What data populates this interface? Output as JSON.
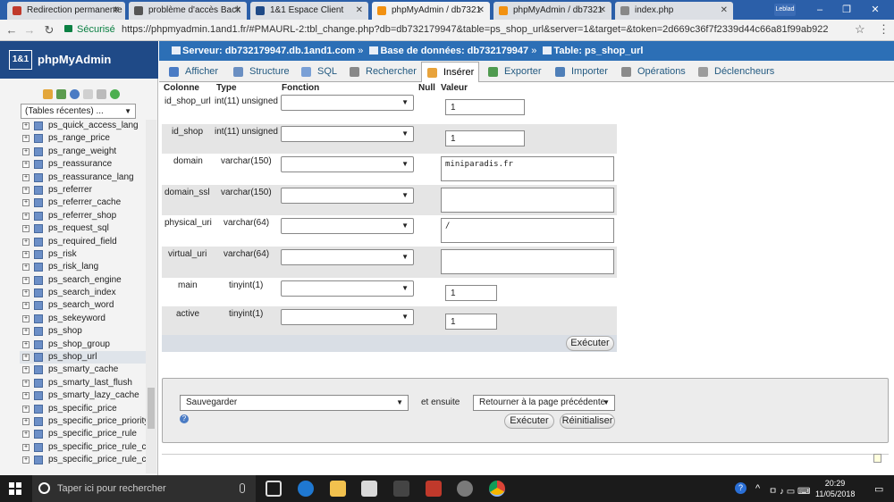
{
  "browser": {
    "tabs": [
      {
        "title": "Redirection permanente",
        "favicon": "page-icon",
        "color": "#c0392b"
      },
      {
        "title": "problème d'accès Back",
        "favicon": "forum-icon",
        "color": "#555555"
      },
      {
        "title": "1&1 Espace Client",
        "favicon": "ionos-icon",
        "color": "#1f4a87"
      },
      {
        "title": "phpMyAdmin / db7321",
        "favicon": "pma-icon",
        "color": "#f29111"
      },
      {
        "title": "phpMyAdmin / db7321",
        "favicon": "pma-icon",
        "color": "#f29111"
      },
      {
        "title": "index.php",
        "favicon": "file-icon",
        "color": "#888888"
      }
    ],
    "user_badge": "Leblad",
    "window_controls": {
      "minimize": "–",
      "maximize": "❐",
      "close": "✕"
    },
    "secure_label": "Sécurisé",
    "url": "https://phpmyadmin.1and1.fr/#PMAURL-2:tbl_change.php?db=db732179947&table=ps_shop_url&server=1&target=&token=2d669c36f7f2339d44c66a81f99ab922"
  },
  "pma": {
    "logo_box": "1&1",
    "logo_text": "phpMyAdmin",
    "recent_tables": "(Tables récentes) ...",
    "tree": [
      "ps_quick_access_lang",
      "ps_range_price",
      "ps_range_weight",
      "ps_reassurance",
      "ps_reassurance_lang",
      "ps_referrer",
      "ps_referrer_cache",
      "ps_referrer_shop",
      "ps_request_sql",
      "ps_required_field",
      "ps_risk",
      "ps_risk_lang",
      "ps_search_engine",
      "ps_search_index",
      "ps_search_word",
      "ps_sekeyword",
      "ps_shop",
      "ps_shop_group",
      "ps_shop_url",
      "ps_smarty_cache",
      "ps_smarty_last_flush",
      "ps_smarty_lazy_cache",
      "ps_specific_price",
      "ps_specific_price_priority",
      "ps_specific_price_rule",
      "ps_specific_price_rule_co",
      "ps_specific_price_rule_co"
    ],
    "selected_table": "ps_shop_url",
    "breadcrumb": {
      "server": "Serveur: db732179947.db.1and1.com",
      "database": "Base de données: db732179947",
      "table": "Table: ps_shop_url",
      "separator": "»"
    },
    "tabs": [
      {
        "label": "Afficher",
        "icon": "browse-icon",
        "color": "#4a7bc4"
      },
      {
        "label": "Structure",
        "icon": "structure-icon",
        "color": "#6b8fc2"
      },
      {
        "label": "SQL",
        "icon": "sql-icon",
        "color": "#7aa0d6"
      },
      {
        "label": "Rechercher",
        "icon": "search-icon",
        "color": "#888888"
      },
      {
        "label": "Insérer",
        "icon": "insert-icon",
        "color": "#e8a33b"
      },
      {
        "label": "Exporter",
        "icon": "export-icon",
        "color": "#4f9a4f"
      },
      {
        "label": "Importer",
        "icon": "import-icon",
        "color": "#4f7fb8"
      },
      {
        "label": "Opérations",
        "icon": "operations-icon",
        "color": "#8b8b8b"
      },
      {
        "label": "Déclencheurs",
        "icon": "triggers-icon",
        "color": "#9c9c9c"
      }
    ],
    "active_tab": "Insérer",
    "form": {
      "headers": {
        "column": "Colonne",
        "type": "Type",
        "function": "Fonction",
        "null": "Null",
        "value": "Valeur"
      },
      "rows": [
        {
          "name": "id_shop_url",
          "type": "int(11) unsigned",
          "value": "1",
          "input": "text"
        },
        {
          "name": "id_shop",
          "type": "int(11) unsigned",
          "value": "1",
          "input": "text"
        },
        {
          "name": "domain",
          "type": "varchar(150)",
          "value": "miniparadis.fr",
          "input": "textarea"
        },
        {
          "name": "domain_ssl",
          "type": "varchar(150)",
          "value": "",
          "input": "textarea"
        },
        {
          "name": "physical_uri",
          "type": "varchar(64)",
          "value": "/",
          "input": "textarea"
        },
        {
          "name": "virtual_uri",
          "type": "varchar(64)",
          "value": "",
          "input": "textarea"
        },
        {
          "name": "main",
          "type": "tinyint(1)",
          "value": "1",
          "input": "small"
        },
        {
          "name": "active",
          "type": "tinyint(1)",
          "value": "1",
          "input": "small"
        }
      ],
      "execute_label": "Exécuter"
    },
    "bottom": {
      "action_select": "Sauvegarder",
      "then_label": "et ensuite",
      "after_select": "Retourner à la page précédente",
      "execute_label": "Exécuter",
      "reset_label": "Réinitialiser",
      "help_glyph": "?"
    }
  },
  "taskbar": {
    "search_placeholder": "Taper ici pour rechercher",
    "apps": [
      {
        "name": "task-view-icon",
        "color": "#3a3a3a"
      },
      {
        "name": "edge-icon",
        "color": "#1f78d1"
      },
      {
        "name": "explorer-icon",
        "color": "#f2c14e"
      },
      {
        "name": "store-icon",
        "color": "#d9d9d9"
      },
      {
        "name": "media-icon",
        "color": "#444444"
      },
      {
        "name": "filezilla-icon",
        "color": "#c0392b"
      },
      {
        "name": "tool-icon",
        "color": "#7a7a7a"
      },
      {
        "name": "chrome-icon",
        "color": "#4caf50"
      }
    ],
    "tray": {
      "help": "?",
      "up": "^",
      "lang_icons": "ㅁ ♪ ▭ ⌨",
      "time": "20:29",
      "date": "11/05/2018",
      "notification": "▭"
    }
  }
}
